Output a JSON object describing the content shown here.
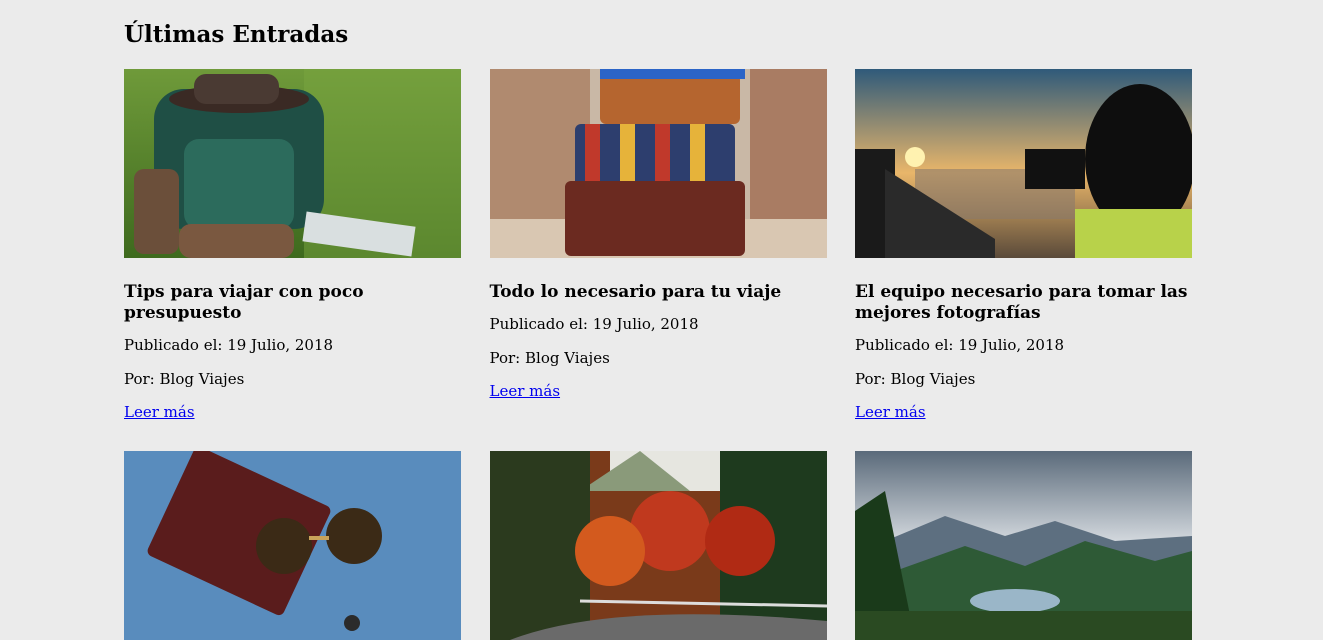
{
  "section": {
    "title": "Últimas Entradas"
  },
  "posts": [
    {
      "title": "Tips para viajar con poco presupuesto",
      "published_label": "Publicado el: 19 Julio, 2018",
      "author_label": "Por: Blog Viajes",
      "read_more": "Leer más",
      "image": "backpack-hiking-boots-photo"
    },
    {
      "title": "Todo lo necesario para tu viaje",
      "published_label": "Publicado el: 19 Julio, 2018",
      "author_label": "Por: Blog Viajes",
      "read_more": "Leer más",
      "image": "stacked-suitcases-photo"
    },
    {
      "title": "El equipo necesario para tomar las mejores fotografías",
      "published_label": "Publicado el: 19 Julio, 2018",
      "author_label": "Por: Blog Viajes",
      "read_more": "Leer más",
      "image": "photographer-sunset-photo"
    },
    {
      "image": "passport-sunglasses-photo"
    },
    {
      "image": "autumn-forest-road-photo"
    },
    {
      "image": "mountain-lake-photo"
    }
  ],
  "colors": {
    "background": "#ebebeb",
    "link": "#0000ee"
  }
}
